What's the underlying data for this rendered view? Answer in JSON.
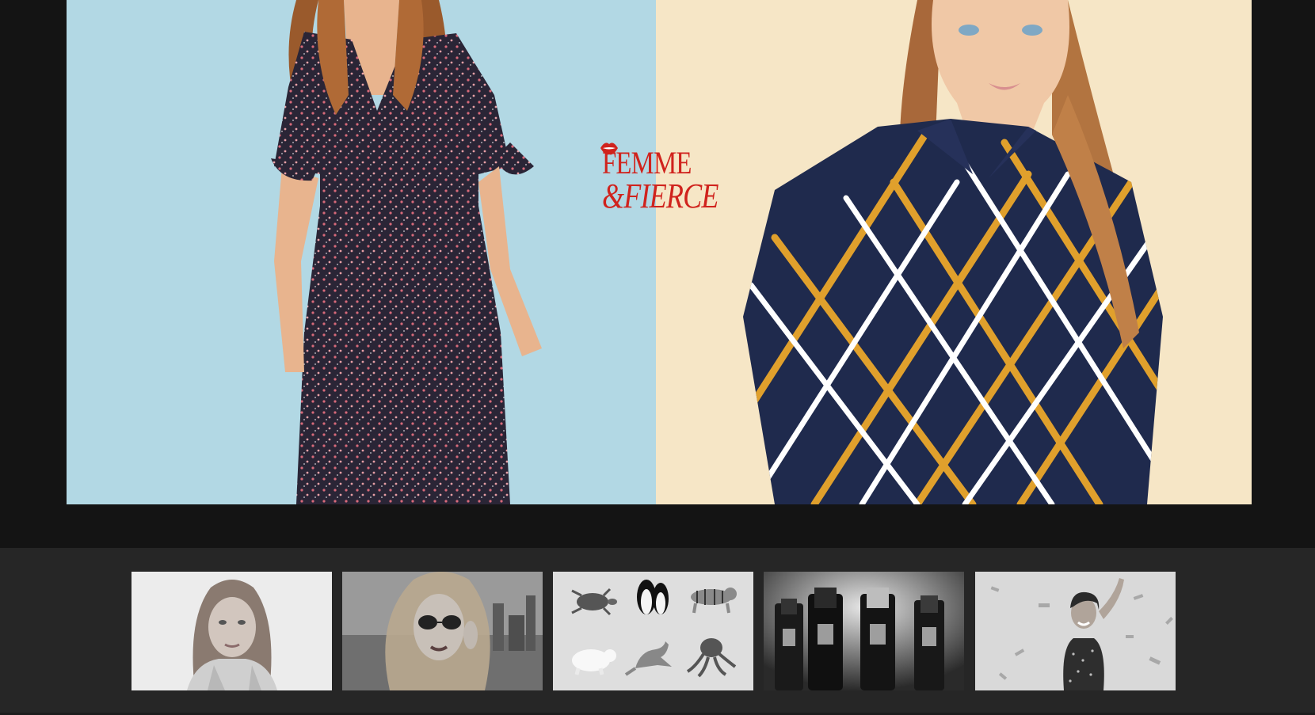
{
  "hero": {
    "brand": {
      "line1": "FEMME",
      "line2": "&FIERCE",
      "color": "#d0231d"
    },
    "left_background": "#b2d8e4",
    "right_background": "#f6e6c6"
  },
  "thumbnails": [
    {
      "icon": "portrait-sweater-photo"
    },
    {
      "icon": "portrait-sunglasses-photo"
    },
    {
      "icon": "animals-illustration"
    },
    {
      "icon": "wine-bottles-photo"
    },
    {
      "icon": "portrait-confetti-photo"
    }
  ]
}
